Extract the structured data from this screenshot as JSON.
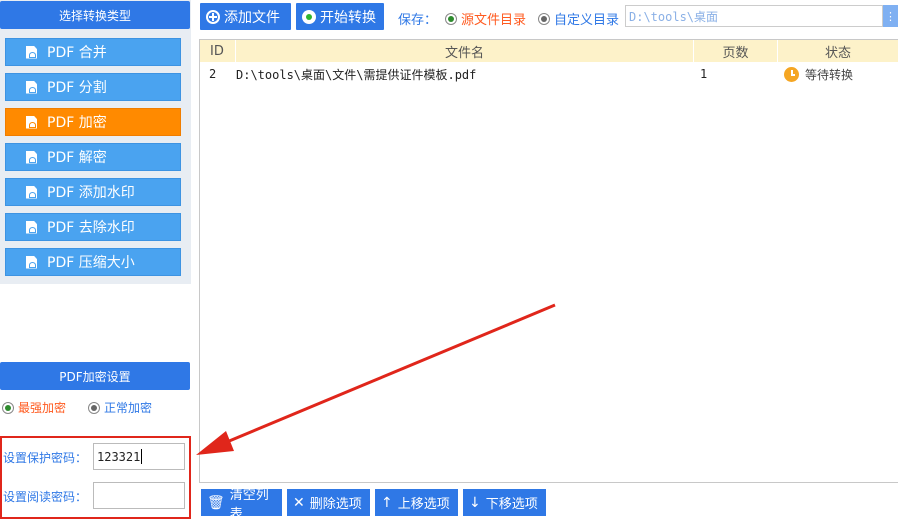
{
  "left_panel": {
    "type_header": "选择转换类型",
    "types": [
      {
        "label": "PDF 合并",
        "active": false
      },
      {
        "label": "PDF 分割",
        "active": false
      },
      {
        "label": "PDF 加密",
        "active": true
      },
      {
        "label": "PDF 解密",
        "active": false
      },
      {
        "label": "PDF 添加水印",
        "active": false
      },
      {
        "label": "PDF 去除水印",
        "active": false
      },
      {
        "label": "PDF 压缩大小",
        "active": false
      }
    ],
    "enc_header": "PDF加密设置",
    "mode_strong": "最强加密",
    "mode_normal": "正常加密",
    "protect_label": "设置保护密码：",
    "protect_value": "123321",
    "read_label": "设置阅读密码：",
    "read_value": ""
  },
  "toolbar": {
    "add_label": "添加文件",
    "start_label": "开始转换",
    "save_label": "保存：",
    "source_dir": "源文件目录",
    "custom_dir": "自定义目录",
    "path_value": "D:\\tools\\桌面"
  },
  "table": {
    "headers": {
      "id": "ID",
      "name": "文件名",
      "pages": "页数",
      "status": "状态"
    },
    "rows": [
      {
        "id": "2",
        "name": "D:\\tools\\桌面\\文件\\需提供证件模板.pdf",
        "pages": "1",
        "status": "等待转换"
      }
    ]
  },
  "bottom": {
    "clear": "清空列表",
    "delete": "删除选项",
    "up": "上移选项",
    "down": "下移选项"
  },
  "colors": {
    "accent": "#2f78e6",
    "type_button": "#4aa3f0",
    "active": "#ff8a00",
    "highlight": "#e0261b"
  }
}
